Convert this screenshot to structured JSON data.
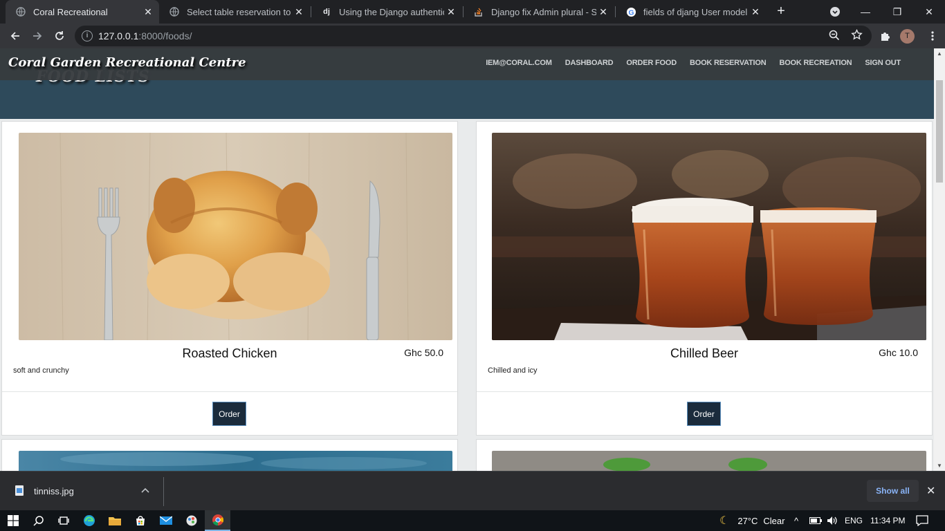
{
  "browser": {
    "tabs": [
      {
        "title": "Coral Recreational",
        "favicon": "globe-icon",
        "active": true
      },
      {
        "title": "Select table reservation to ch",
        "favicon": "globe-icon",
        "active": false
      },
      {
        "title": "Using the Django authenticat",
        "favicon": "django-icon",
        "active": false
      },
      {
        "title": "Django fix Admin plural - Sta",
        "favicon": "stackoverflow-icon",
        "active": false
      },
      {
        "title": "fields of djang User model - (",
        "favicon": "google-icon",
        "active": false
      }
    ],
    "url_host": "127.0.0.1",
    "url_path": ":8000/foods/",
    "profile_initial": "T"
  },
  "site": {
    "brand": "Coral Garden Recreational Centre",
    "under_title": "FOOD LISTS",
    "nav": [
      "IEM@CORAL.COM",
      "DASHBOARD",
      "ORDER FOOD",
      "BOOK RESERVATION",
      "BOOK RECREATION",
      "SIGN OUT"
    ]
  },
  "foods": [
    {
      "name": "Roasted Chicken",
      "price": "Ghc 50.0",
      "description": "soft and crunchy",
      "order_label": "Order",
      "image": "roasted-chicken-photo"
    },
    {
      "name": "Chilled Beer",
      "price": "Ghc 10.0",
      "description": "Chilled and icy",
      "order_label": "Order",
      "image": "chilled-beer-photo"
    }
  ],
  "download_shelf": {
    "filename": "tinniss.jpg",
    "show_all": "Show all"
  },
  "taskbar": {
    "temperature": "27°C",
    "weather": "Clear",
    "language": "ENG",
    "time": "11:34 PM"
  },
  "colors": {
    "navbar": "#373b3e",
    "band": "#2e4a5b",
    "order_button": "#1b2b3c",
    "showall_text": "#8ab4f8"
  }
}
